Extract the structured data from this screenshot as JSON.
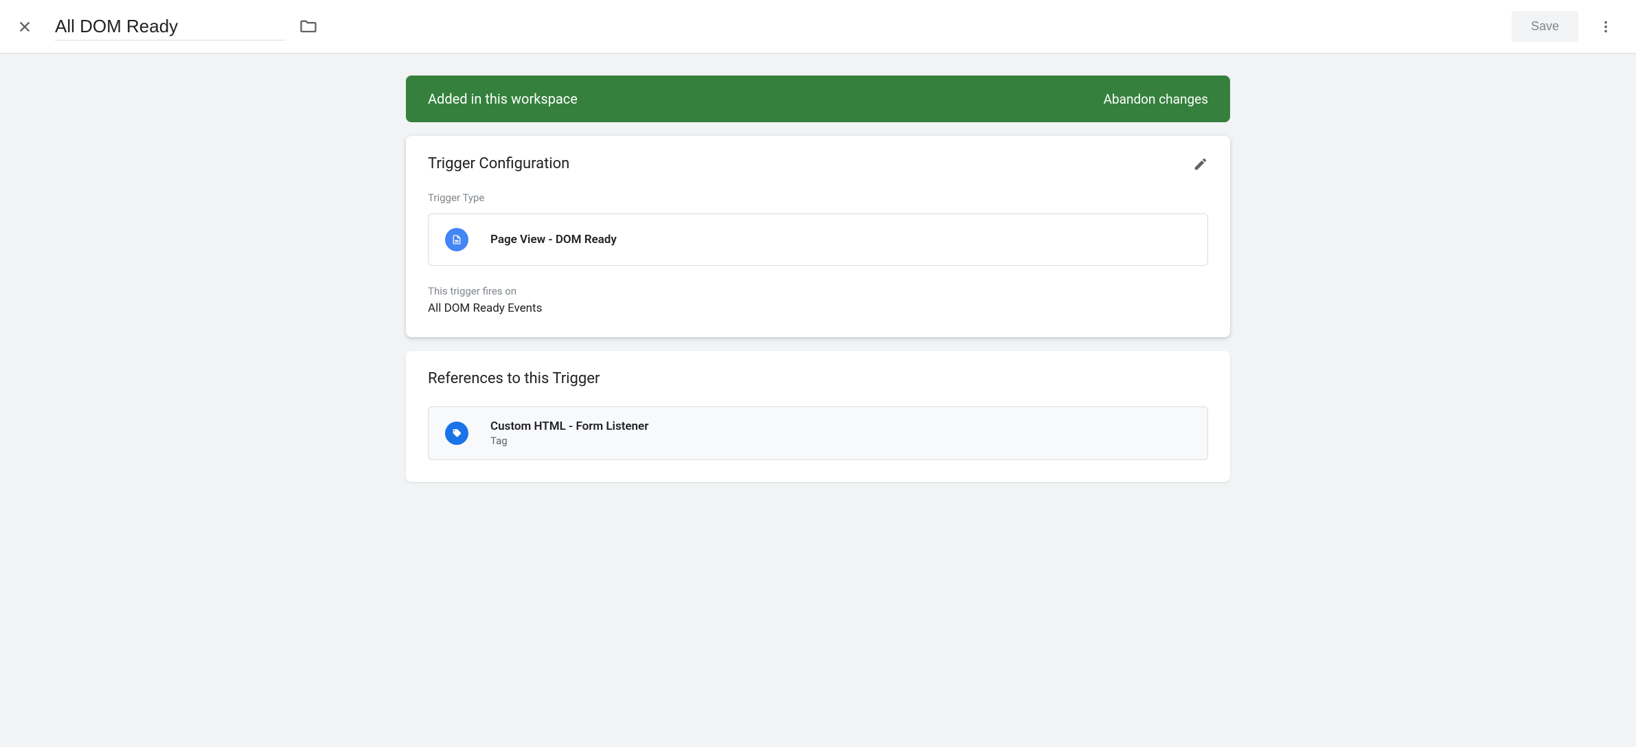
{
  "header": {
    "title": "All DOM Ready",
    "save_label": "Save"
  },
  "workspace_banner": {
    "message": "Added in this workspace",
    "abandon_label": "Abandon changes"
  },
  "trigger_config": {
    "section_title": "Trigger Configuration",
    "type_label": "Trigger Type",
    "type_name": "Page View - DOM Ready",
    "fires_on_label": "This trigger fires on",
    "fires_on_value": "All DOM Ready Events"
  },
  "references": {
    "section_title": "References to this Trigger",
    "items": [
      {
        "name": "Custom HTML - Form Listener",
        "type": "Tag"
      }
    ]
  }
}
